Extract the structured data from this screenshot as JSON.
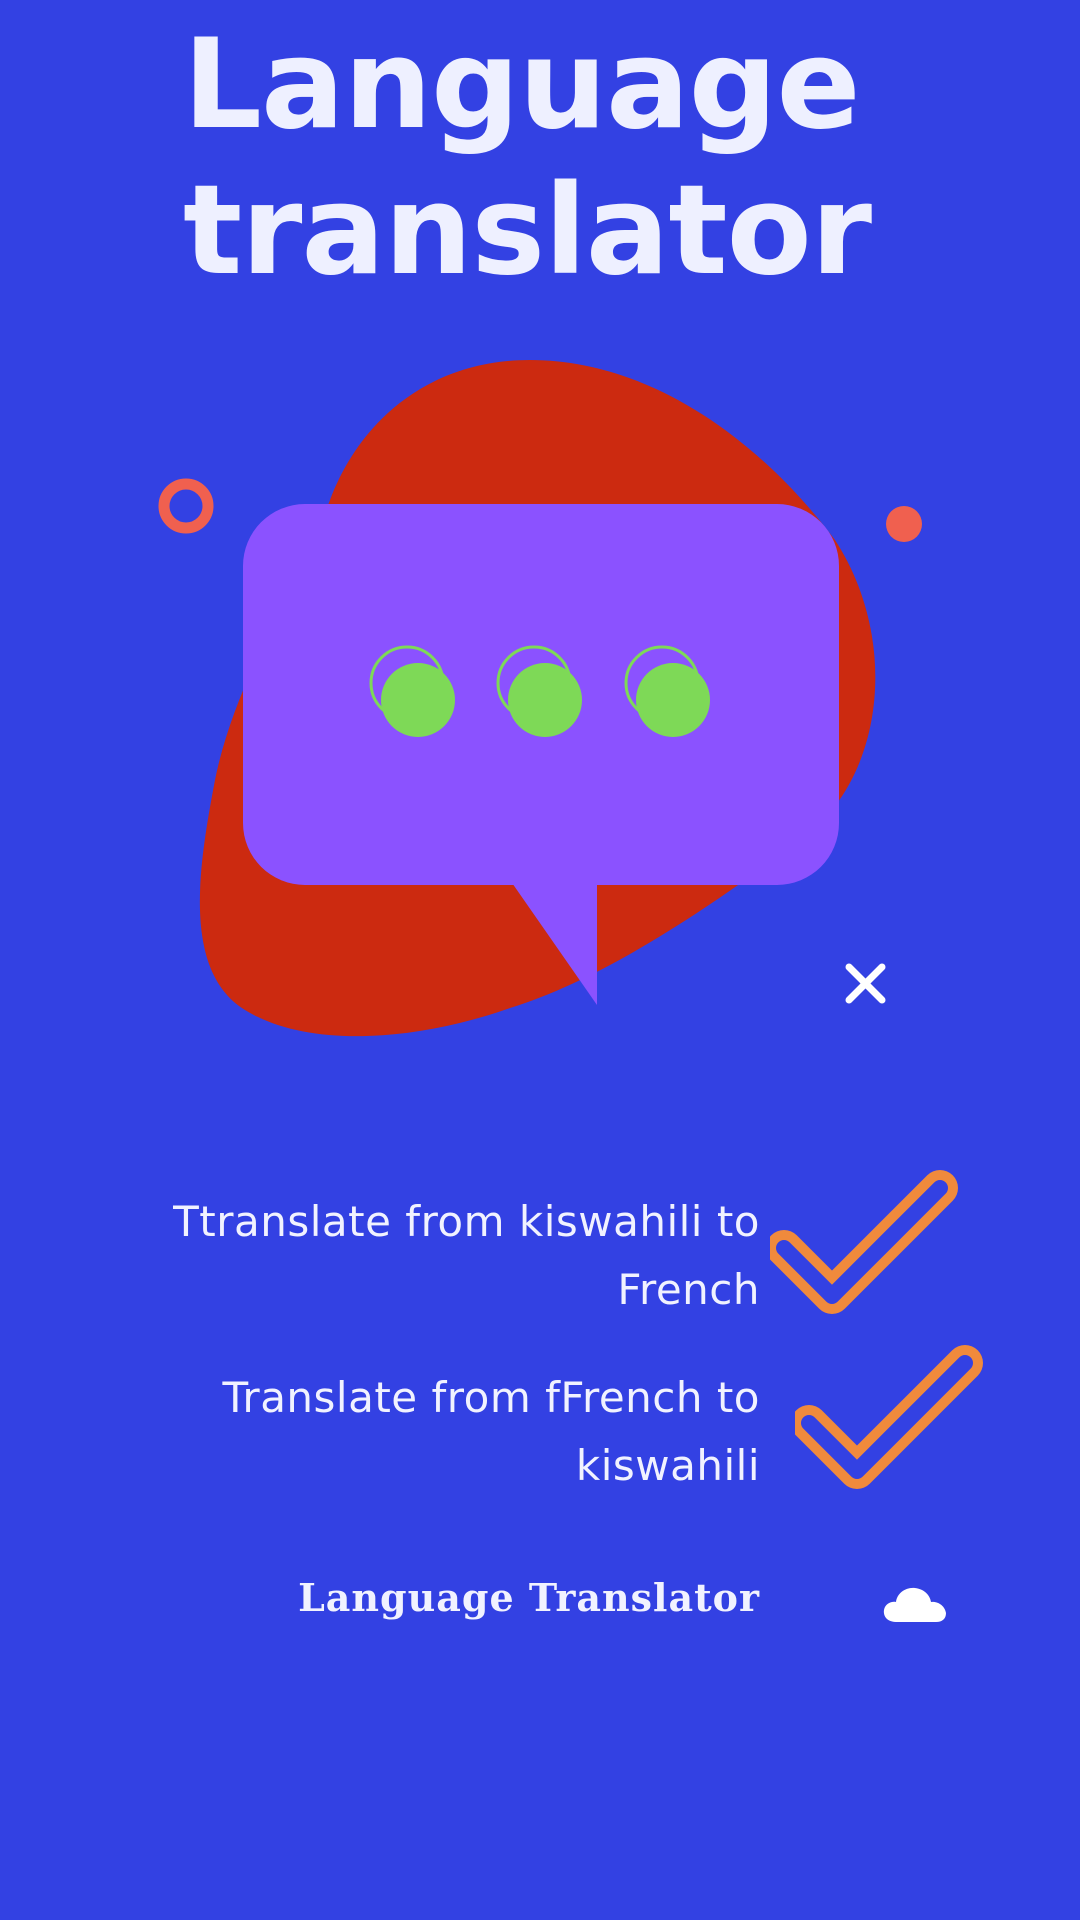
{
  "header": {
    "title_line1": "Language",
    "title_line2": "translator"
  },
  "illustration": {
    "icon_name": "chat-bubble-typing-icon",
    "colors": {
      "background": "#3341e3",
      "blob": "#cc2a10",
      "bubble": "#8b52ff",
      "dots": "#7ed957",
      "accent_coral": "#f0604f",
      "accent_white": "#ffffff"
    }
  },
  "features": [
    {
      "text": "Ttranslate from kiswahili to French",
      "icon": "checkmark-icon"
    },
    {
      "text": "Translate from fFrench to kiswahili",
      "icon": "checkmark-icon"
    }
  ],
  "footer": {
    "label": "Language Translator",
    "icon": "cloud-icon"
  },
  "colors": {
    "text": "#eef0ff",
    "check": "#f08a3c"
  }
}
